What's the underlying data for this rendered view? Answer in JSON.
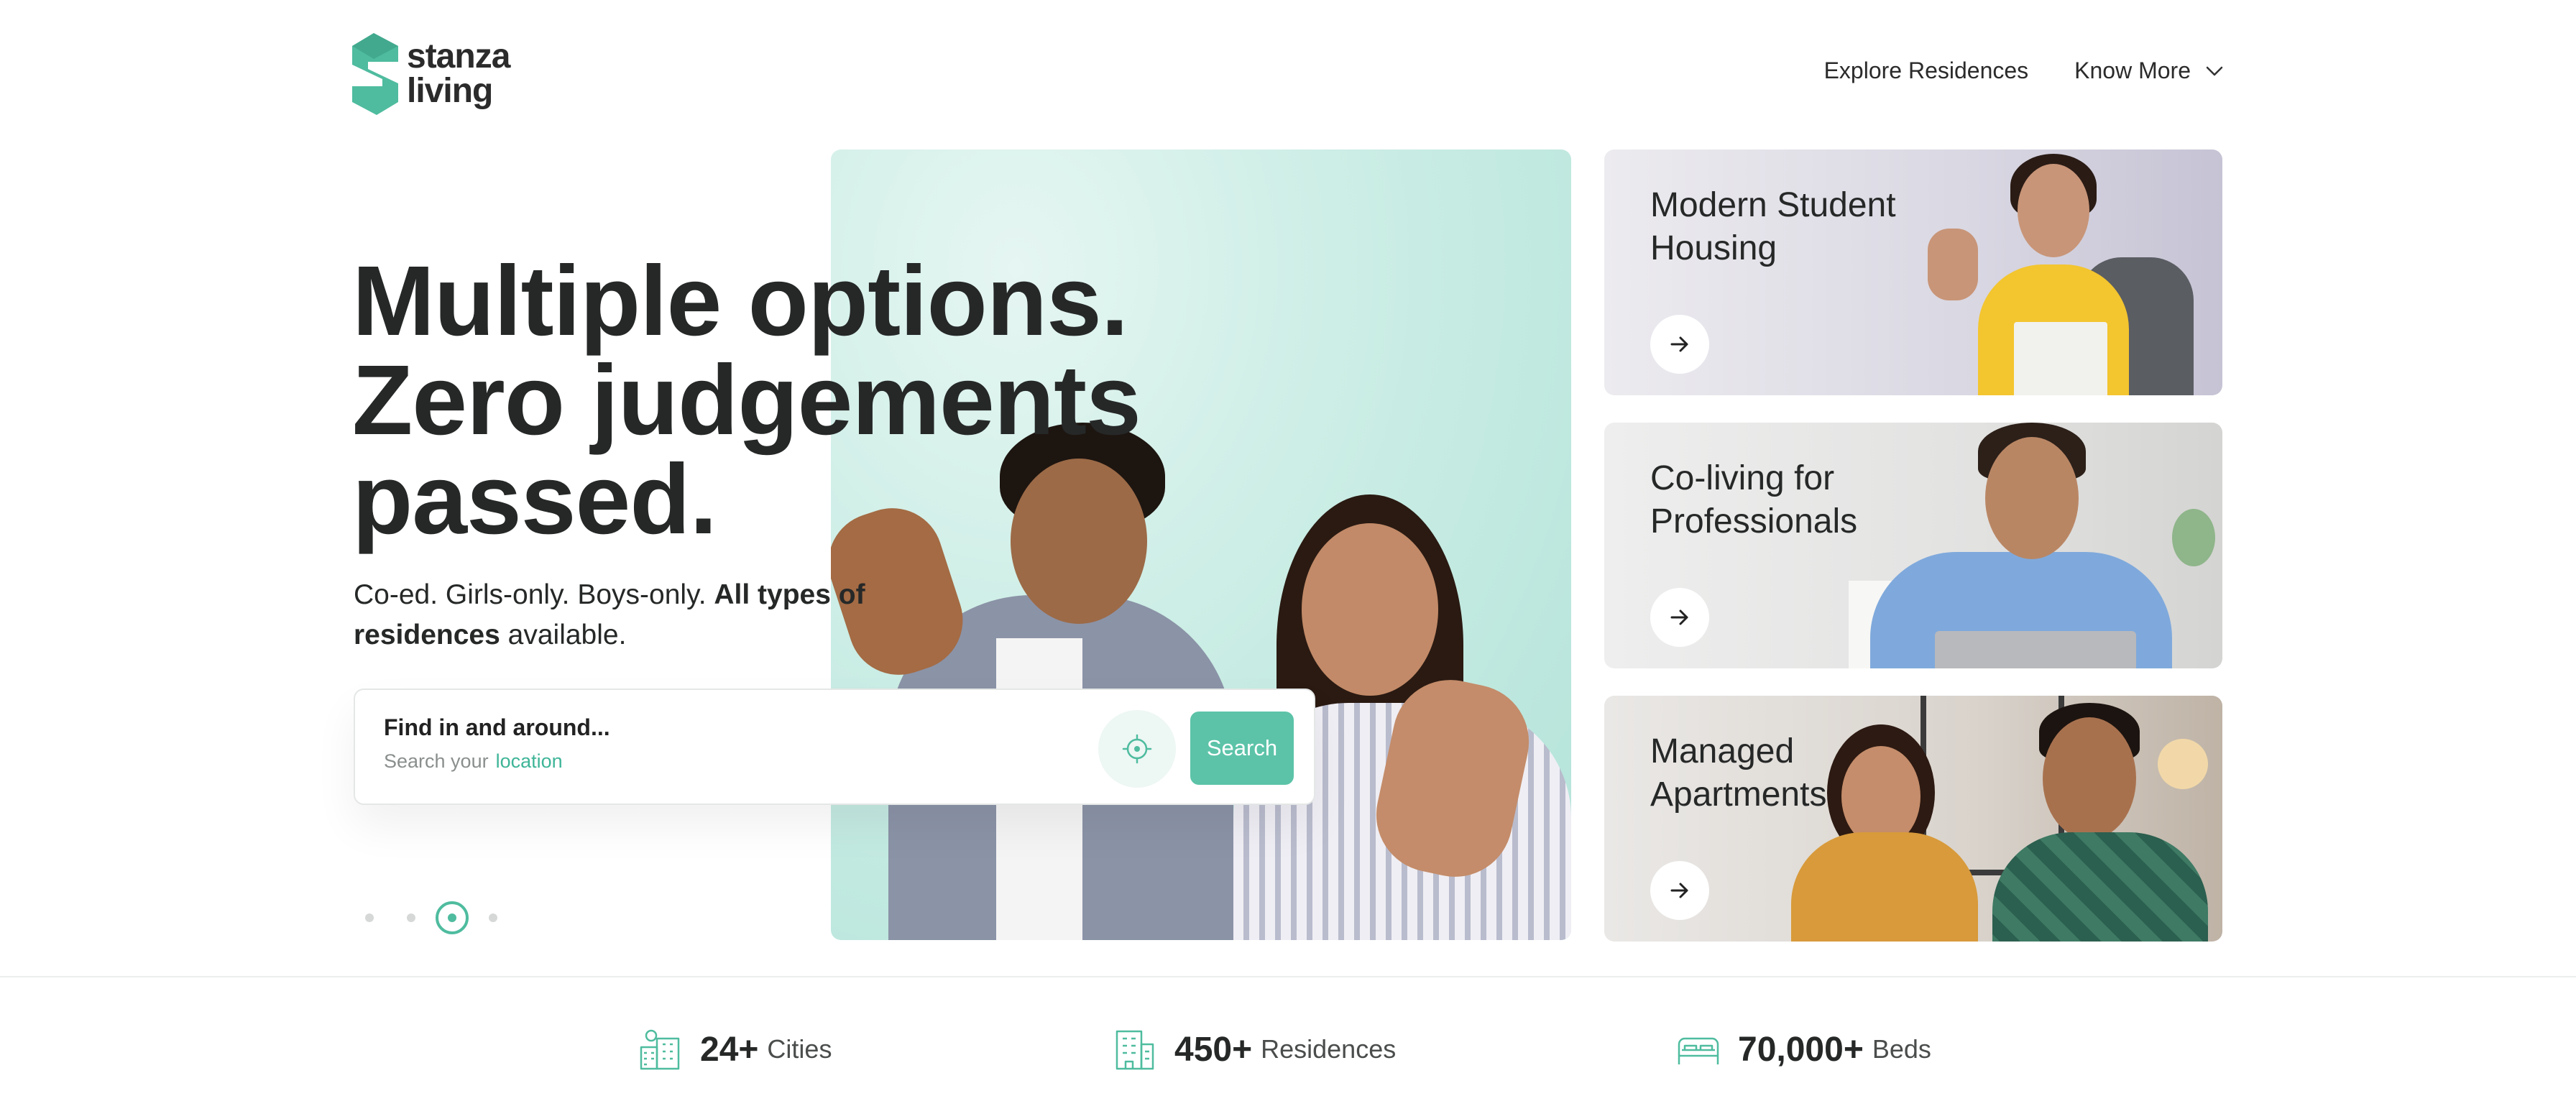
{
  "brand": {
    "name_line1": "stanza",
    "name_line2": "living",
    "accent": "#4fbc9f"
  },
  "nav": {
    "items": [
      {
        "label": "Explore Residences"
      },
      {
        "label": "Know More",
        "icon": "chevron-down-icon"
      }
    ]
  },
  "hero": {
    "headline": [
      "Multiple options.",
      "Zero judgements",
      "passed."
    ],
    "sub_plain1": "Co-ed. Girls-only. Boys-only. ",
    "sub_bold": "All types of residences",
    "sub_plain2": " available.",
    "carousel": {
      "total": 4,
      "active_index": 3
    }
  },
  "search": {
    "title": "Find in and around...",
    "placeholder_prefix": "Search your",
    "placeholder_highlight": "location",
    "locate_icon": "crosshair-icon",
    "button_label": "Search"
  },
  "cards": [
    {
      "title_line1": "Modern Student",
      "title_line2": "Housing",
      "icon": "arrow-right-icon"
    },
    {
      "title_line1": "Co-living for",
      "title_line2": "Professionals",
      "icon": "arrow-right-icon"
    },
    {
      "title_line1": "Managed",
      "title_line2": "Apartments",
      "icon": "arrow-right-icon"
    }
  ],
  "stats": [
    {
      "value": "24+",
      "label": "Cities",
      "icon": "city-icon"
    },
    {
      "value": "450+",
      "label": "Residences",
      "icon": "building-icon"
    },
    {
      "value": "70,000+",
      "label": "Beds",
      "icon": "bed-icon"
    }
  ]
}
